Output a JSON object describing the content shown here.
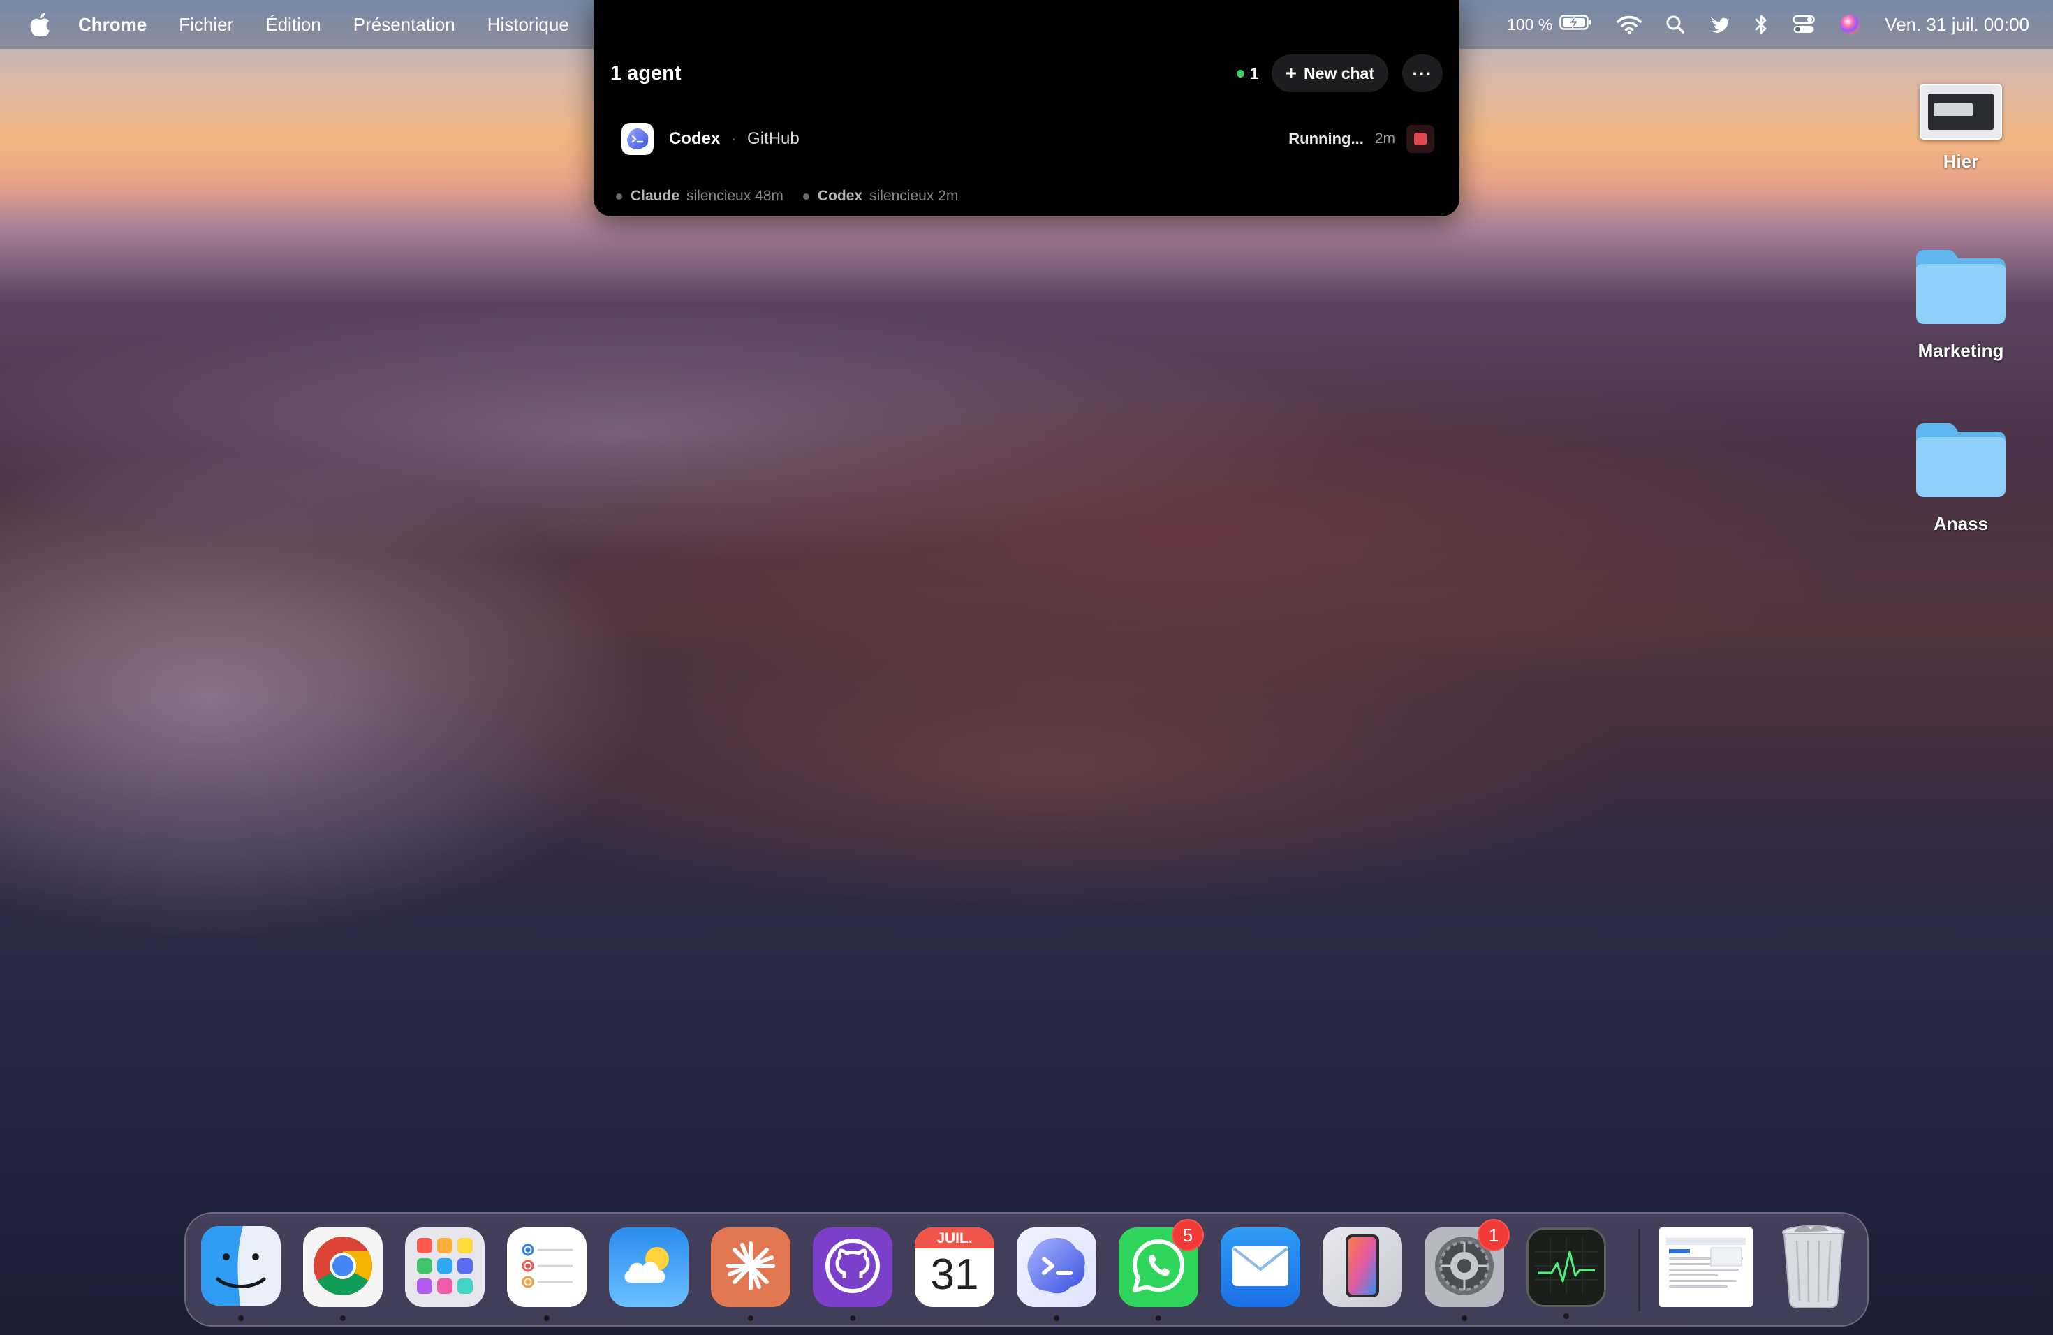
{
  "menubar": {
    "apple_icon": "apple-icon",
    "app_name": "Chrome",
    "menus": [
      "Fichier",
      "Édition",
      "Présentation",
      "Historique"
    ],
    "battery_percent": "100 %",
    "clock": "Ven. 31 juil.  00:00",
    "status_icons": [
      "battery-charging-icon",
      "wifi-icon",
      "search-icon",
      "bird-icon",
      "bluetooth-icon",
      "control-center-icon",
      "siri-icon"
    ]
  },
  "agent_panel": {
    "title": "1 agent",
    "active_count": "1",
    "new_chat_label": "New chat",
    "more_label": "···",
    "agent": {
      "name": "Codex",
      "source": "GitHub",
      "status": "Running...",
      "elapsed": "2m"
    },
    "history": [
      {
        "name": "Claude",
        "status": "silencieux 48m"
      },
      {
        "name": "Codex",
        "status": "silencieux 2m"
      }
    ]
  },
  "desktop": {
    "items": [
      {
        "label": "Hier",
        "kind": "screenshot"
      },
      {
        "label": "Marketing",
        "kind": "folder"
      },
      {
        "label": "Anass",
        "kind": "folder"
      }
    ]
  },
  "dock": {
    "calendar_month": "JUIL.",
    "calendar_day": "31",
    "whatsapp_badge": "5",
    "settings_badge": "1",
    "apps": [
      "finder",
      "chrome",
      "launchpad",
      "reminders",
      "weather",
      "claude",
      "github-desktop",
      "calendar",
      "agent-app",
      "whatsapp",
      "mail",
      "iphone-mirroring",
      "system-settings",
      "activity-monitor",
      "document-preview",
      "trash"
    ]
  }
}
